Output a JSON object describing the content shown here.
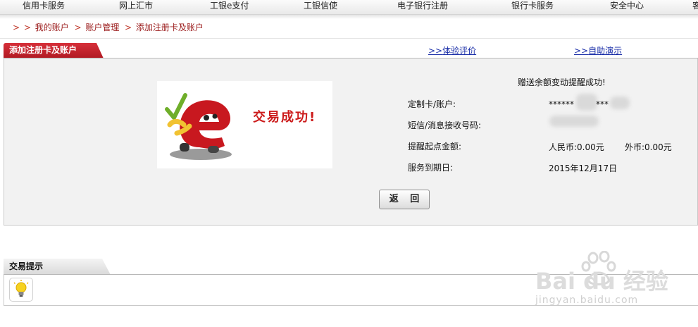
{
  "topnav": {
    "items": [
      "信用卡服务",
      "网上汇市",
      "工银e支付",
      "工银信使",
      "电子银行注册",
      "银行卡服务",
      "安全中心",
      "客"
    ]
  },
  "breadcrumb": {
    "items": [
      "我的账户",
      "账户管理",
      "添加注册卡及账户"
    ]
  },
  "section": {
    "title": "添加注册卡及账户",
    "link1": "体验评价",
    "link2": "自助演示"
  },
  "result": {
    "success_text": "交易成功!",
    "notice": "赠送余额变动提醒成功!",
    "fields": [
      {
        "label": "定制卡/账户:",
        "value": "******"
      },
      {
        "label": "短信/消息接收号码:",
        "value": ""
      },
      {
        "label": "提醒起点金额:",
        "value": "人民币:0.00元"
      },
      {
        "label": "服务到期日:",
        "value": "2015年12月17日"
      }
    ],
    "card_suffix": "***",
    "foreign_amount": "外币:0.00元",
    "back_button": "返 回"
  },
  "tips": {
    "title": "交易提示"
  },
  "watermark": {
    "brand": "Bai du 经验",
    "url": "jingyan.baidu.com"
  },
  "colors": {
    "accent": "#c81f28",
    "link": "#1a2ea8",
    "panel_bg": "#f2f2f2"
  }
}
